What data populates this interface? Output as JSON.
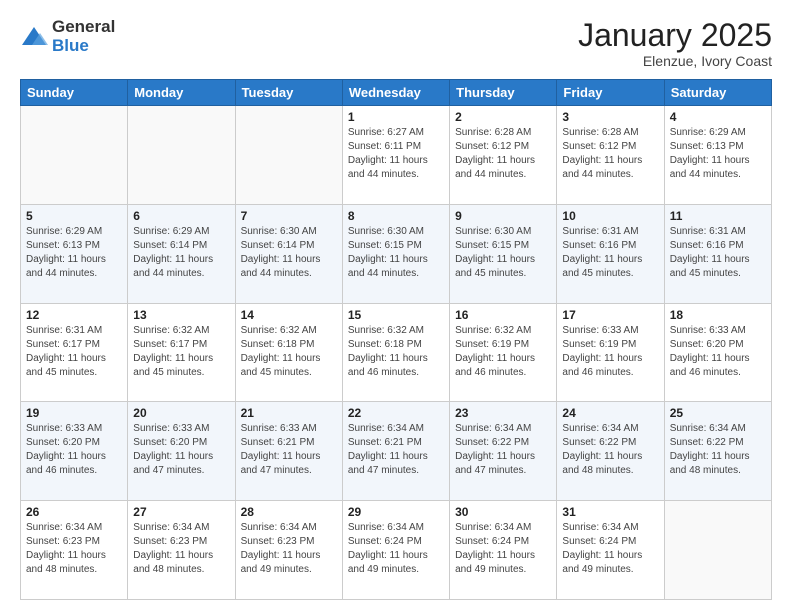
{
  "logo": {
    "general": "General",
    "blue": "Blue"
  },
  "header": {
    "month": "January 2025",
    "location": "Elenzue, Ivory Coast"
  },
  "days_of_week": [
    "Sunday",
    "Monday",
    "Tuesday",
    "Wednesday",
    "Thursday",
    "Friday",
    "Saturday"
  ],
  "weeks": [
    [
      {
        "day": "",
        "info": ""
      },
      {
        "day": "",
        "info": ""
      },
      {
        "day": "",
        "info": ""
      },
      {
        "day": "1",
        "info": "Sunrise: 6:27 AM\nSunset: 6:11 PM\nDaylight: 11 hours and 44 minutes."
      },
      {
        "day": "2",
        "info": "Sunrise: 6:28 AM\nSunset: 6:12 PM\nDaylight: 11 hours and 44 minutes."
      },
      {
        "day": "3",
        "info": "Sunrise: 6:28 AM\nSunset: 6:12 PM\nDaylight: 11 hours and 44 minutes."
      },
      {
        "day": "4",
        "info": "Sunrise: 6:29 AM\nSunset: 6:13 PM\nDaylight: 11 hours and 44 minutes."
      }
    ],
    [
      {
        "day": "5",
        "info": "Sunrise: 6:29 AM\nSunset: 6:13 PM\nDaylight: 11 hours and 44 minutes."
      },
      {
        "day": "6",
        "info": "Sunrise: 6:29 AM\nSunset: 6:14 PM\nDaylight: 11 hours and 44 minutes."
      },
      {
        "day": "7",
        "info": "Sunrise: 6:30 AM\nSunset: 6:14 PM\nDaylight: 11 hours and 44 minutes."
      },
      {
        "day": "8",
        "info": "Sunrise: 6:30 AM\nSunset: 6:15 PM\nDaylight: 11 hours and 44 minutes."
      },
      {
        "day": "9",
        "info": "Sunrise: 6:30 AM\nSunset: 6:15 PM\nDaylight: 11 hours and 45 minutes."
      },
      {
        "day": "10",
        "info": "Sunrise: 6:31 AM\nSunset: 6:16 PM\nDaylight: 11 hours and 45 minutes."
      },
      {
        "day": "11",
        "info": "Sunrise: 6:31 AM\nSunset: 6:16 PM\nDaylight: 11 hours and 45 minutes."
      }
    ],
    [
      {
        "day": "12",
        "info": "Sunrise: 6:31 AM\nSunset: 6:17 PM\nDaylight: 11 hours and 45 minutes."
      },
      {
        "day": "13",
        "info": "Sunrise: 6:32 AM\nSunset: 6:17 PM\nDaylight: 11 hours and 45 minutes."
      },
      {
        "day": "14",
        "info": "Sunrise: 6:32 AM\nSunset: 6:18 PM\nDaylight: 11 hours and 45 minutes."
      },
      {
        "day": "15",
        "info": "Sunrise: 6:32 AM\nSunset: 6:18 PM\nDaylight: 11 hours and 46 minutes."
      },
      {
        "day": "16",
        "info": "Sunrise: 6:32 AM\nSunset: 6:19 PM\nDaylight: 11 hours and 46 minutes."
      },
      {
        "day": "17",
        "info": "Sunrise: 6:33 AM\nSunset: 6:19 PM\nDaylight: 11 hours and 46 minutes."
      },
      {
        "day": "18",
        "info": "Sunrise: 6:33 AM\nSunset: 6:20 PM\nDaylight: 11 hours and 46 minutes."
      }
    ],
    [
      {
        "day": "19",
        "info": "Sunrise: 6:33 AM\nSunset: 6:20 PM\nDaylight: 11 hours and 46 minutes."
      },
      {
        "day": "20",
        "info": "Sunrise: 6:33 AM\nSunset: 6:20 PM\nDaylight: 11 hours and 47 minutes."
      },
      {
        "day": "21",
        "info": "Sunrise: 6:33 AM\nSunset: 6:21 PM\nDaylight: 11 hours and 47 minutes."
      },
      {
        "day": "22",
        "info": "Sunrise: 6:34 AM\nSunset: 6:21 PM\nDaylight: 11 hours and 47 minutes."
      },
      {
        "day": "23",
        "info": "Sunrise: 6:34 AM\nSunset: 6:22 PM\nDaylight: 11 hours and 47 minutes."
      },
      {
        "day": "24",
        "info": "Sunrise: 6:34 AM\nSunset: 6:22 PM\nDaylight: 11 hours and 48 minutes."
      },
      {
        "day": "25",
        "info": "Sunrise: 6:34 AM\nSunset: 6:22 PM\nDaylight: 11 hours and 48 minutes."
      }
    ],
    [
      {
        "day": "26",
        "info": "Sunrise: 6:34 AM\nSunset: 6:23 PM\nDaylight: 11 hours and 48 minutes."
      },
      {
        "day": "27",
        "info": "Sunrise: 6:34 AM\nSunset: 6:23 PM\nDaylight: 11 hours and 48 minutes."
      },
      {
        "day": "28",
        "info": "Sunrise: 6:34 AM\nSunset: 6:23 PM\nDaylight: 11 hours and 49 minutes."
      },
      {
        "day": "29",
        "info": "Sunrise: 6:34 AM\nSunset: 6:24 PM\nDaylight: 11 hours and 49 minutes."
      },
      {
        "day": "30",
        "info": "Sunrise: 6:34 AM\nSunset: 6:24 PM\nDaylight: 11 hours and 49 minutes."
      },
      {
        "day": "31",
        "info": "Sunrise: 6:34 AM\nSunset: 6:24 PM\nDaylight: 11 hours and 49 minutes."
      },
      {
        "day": "",
        "info": ""
      }
    ]
  ]
}
